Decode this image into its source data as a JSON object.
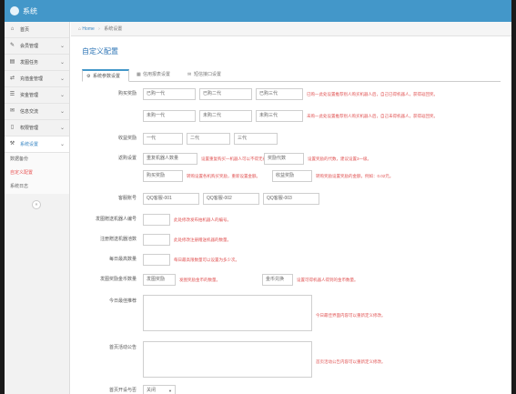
{
  "app": {
    "title": "系统"
  },
  "sidebar": {
    "items": [
      {
        "label": "首页",
        "icon": "home-icon",
        "glyph": "⌂"
      },
      {
        "label": "会员管理",
        "icon": "edit-icon",
        "glyph": "✎"
      },
      {
        "label": "发图任务",
        "icon": "book-icon",
        "glyph": "▤"
      },
      {
        "label": "充值金管理",
        "icon": "shuffle-icon",
        "glyph": "⇄"
      },
      {
        "label": "资金管理",
        "icon": "list-icon",
        "glyph": "☰"
      },
      {
        "label": "信息交流",
        "icon": "chat-icon",
        "glyph": "✉"
      },
      {
        "label": "权限管理",
        "icon": "file-icon",
        "glyph": "▯"
      },
      {
        "label": "系统设置",
        "icon": "wrench-icon",
        "glyph": "⚒"
      }
    ],
    "sub_items": [
      "数据备份",
      "自定义配置",
      "系统日志"
    ]
  },
  "breadcrumb": {
    "home": "Home",
    "current": "系统设置"
  },
  "page_title": "自定义配置",
  "tabs": [
    "系统参数设置",
    "信用报表设置",
    "短信接口设置"
  ],
  "form": {
    "purchase_ratio_label": "购买奖励",
    "purchase_row1": [
      "已购一代",
      "已购二代",
      "已购三代"
    ],
    "purchase_row1_hint": "已购一此处设置推荐别人购买机器人后，自己已得机器人，获得返回奖。",
    "purchase_row2": [
      "未购一代",
      "未购二代",
      "未购三代"
    ],
    "purchase_row2_hint": "未购一此处设置推荐别人购买机器人后，自己未得机器人，获得返回奖。",
    "income_label": "收益奖励",
    "income_fields": [
      "一代",
      "二代",
      "三代"
    ],
    "repurchase_label": "返购设置",
    "repurchase_field1": "重复机器人数量",
    "repurchase_hint1": "设置重复购买一机器人可以不得无有效生",
    "repurchase_field2": "奖励代数",
    "repurchase_hint2": "设置奖励的代数，建议设置3一级。",
    "repurchase_field3": "购买奖励",
    "repurchase_hint3": "转购设置各机购买奖励，重新设置金额。",
    "repurchase_field4": "收益奖励",
    "repurchase_hint4": "转购奖励设置奖励的金额，例如：0.02元。",
    "customer_label": "客服账号",
    "customer_fields": [
      "QQ客服-001",
      "QQ客服-002",
      "QQ客服-003"
    ],
    "robot_label": "发图赠送机器人编号",
    "robot_hint": "此处修改发布拍机器人的编号。",
    "register_label": "注册赠送机器池数",
    "register_hint": "此处修改注册赠送机器的数量。",
    "daily_limit_label": "每日最高数量",
    "daily_limit_hint": "每日最高限数量可以设置为多少次。",
    "reward_label": "发图奖励金币数量",
    "reward_field1": "发图奖励",
    "reward_hint1": "发图奖励金币的数量。",
    "reward_field2": "金币兑换",
    "reward_hint2": "设置可得机器人得到的金币数量。",
    "today_label": "今日最佳推荐",
    "today_hint": "今日最佳界面内容可以重新定义修改。",
    "homepage_label": "首页活动公告",
    "homepage_hint": "首页活动公告内容可以重新定义修改。",
    "open_label": "首页开设与否",
    "open_value": "关闭"
  }
}
